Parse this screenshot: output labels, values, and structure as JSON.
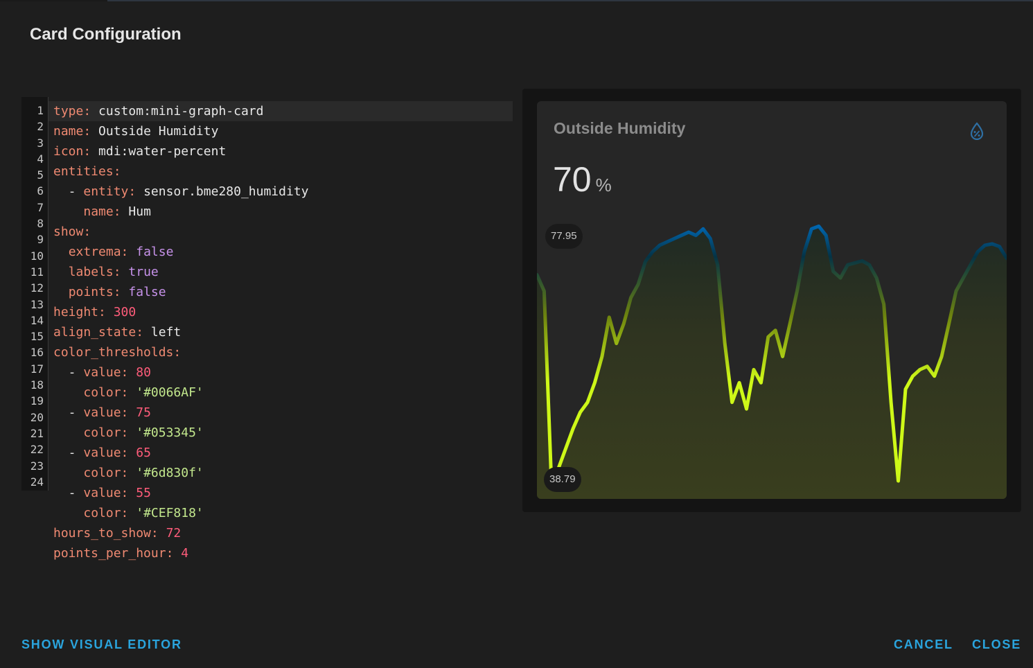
{
  "dialog": {
    "title": "Card Configuration"
  },
  "editor": {
    "line_numbers": [
      "1",
      "2",
      "3",
      "4",
      "5",
      "6",
      "7",
      "8",
      "9",
      "10",
      "11",
      "12",
      "13",
      "14",
      "15",
      "16",
      "17",
      "18",
      "19",
      "20",
      "21",
      "22",
      "23",
      "24"
    ],
    "lines": [
      {
        "indent": "",
        "key": "type",
        "sep": ": ",
        "value": "custom:mini-graph-card",
        "vtype": "s"
      },
      {
        "indent": "",
        "key": "name",
        "sep": ": ",
        "value": "Outside Humidity",
        "vtype": "s"
      },
      {
        "indent": "",
        "key": "icon",
        "sep": ": ",
        "value": "mdi:water-percent",
        "vtype": "s"
      },
      {
        "indent": "",
        "key": "entities",
        "sep": ":",
        "value": "",
        "vtype": "s"
      },
      {
        "indent": "  - ",
        "key": "entity",
        "sep": ": ",
        "value": "sensor.bme280_humidity",
        "vtype": "s"
      },
      {
        "indent": "    ",
        "key": "name",
        "sep": ": ",
        "value": "Hum",
        "vtype": "s"
      },
      {
        "indent": "",
        "key": "show",
        "sep": ":",
        "value": "",
        "vtype": "s"
      },
      {
        "indent": "  ",
        "key": "extrema",
        "sep": ": ",
        "value": "false",
        "vtype": "b"
      },
      {
        "indent": "  ",
        "key": "labels",
        "sep": ": ",
        "value": "true",
        "vtype": "b"
      },
      {
        "indent": "  ",
        "key": "points",
        "sep": ": ",
        "value": "false",
        "vtype": "b"
      },
      {
        "indent": "",
        "key": "height",
        "sep": ": ",
        "value": "300",
        "vtype": "n"
      },
      {
        "indent": "",
        "key": "align_state",
        "sep": ": ",
        "value": "left",
        "vtype": "s"
      },
      {
        "indent": "",
        "key": "color_thresholds",
        "sep": ":",
        "value": "",
        "vtype": "s"
      },
      {
        "indent": "  - ",
        "key": "value",
        "sep": ": ",
        "value": "80",
        "vtype": "n"
      },
      {
        "indent": "    ",
        "key": "color",
        "sep": ": ",
        "value": "'#0066AF'",
        "vtype": "q"
      },
      {
        "indent": "  - ",
        "key": "value",
        "sep": ": ",
        "value": "75",
        "vtype": "n"
      },
      {
        "indent": "    ",
        "key": "color",
        "sep": ": ",
        "value": "'#053345'",
        "vtype": "q"
      },
      {
        "indent": "  - ",
        "key": "value",
        "sep": ": ",
        "value": "65",
        "vtype": "n"
      },
      {
        "indent": "    ",
        "key": "color",
        "sep": ": ",
        "value": "'#6d830f'",
        "vtype": "q"
      },
      {
        "indent": "  - ",
        "key": "value",
        "sep": ": ",
        "value": "55",
        "vtype": "n"
      },
      {
        "indent": "    ",
        "key": "color",
        "sep": ": ",
        "value": "'#CEF818'",
        "vtype": "q"
      },
      {
        "indent": "",
        "key": "hours_to_show",
        "sep": ": ",
        "value": "72",
        "vtype": "n"
      },
      {
        "indent": "",
        "key": "points_per_hour",
        "sep": ": ",
        "value": "4",
        "vtype": "n"
      }
    ]
  },
  "card": {
    "name": "Outside Humidity",
    "icon": "water-percent-icon",
    "state_value": "70",
    "state_unit": "%",
    "label_max": "77.95",
    "label_min": "38.79"
  },
  "chart_data": {
    "type": "area",
    "series": [
      {
        "values": [
          70.5,
          68,
          38.8,
          41,
          44,
          47,
          49.5,
          51,
          54,
          58,
          64,
          60,
          63,
          67,
          69,
          72.5,
          74,
          75,
          75.5,
          76,
          76.5,
          77,
          76.5,
          77.5,
          76,
          72,
          60,
          51,
          54,
          50,
          56,
          54,
          61,
          62,
          58,
          63,
          68,
          74,
          77.5,
          77.9,
          76.5,
          71,
          70,
          72,
          72.3,
          72.6,
          72,
          70,
          66,
          51,
          39,
          53,
          55,
          56,
          56.5,
          55,
          58,
          63,
          68,
          70,
          72,
          74,
          75,
          75.2,
          74.8,
          73
        ]
      }
    ],
    "ylim": [
      38.79,
      77.95
    ],
    "color_thresholds": [
      {
        "value": 80,
        "color": "#0066AF"
      },
      {
        "value": 75,
        "color": "#053345"
      },
      {
        "value": 65,
        "color": "#6d830f"
      },
      {
        "value": 55,
        "color": "#CEF818"
      }
    ]
  },
  "footer": {
    "show_visual_editor": "SHOW VISUAL EDITOR",
    "cancel": "CANCEL",
    "close": "CLOSE"
  },
  "colors": {
    "accent": "#2aa4dd",
    "background": "#1e1e1e"
  }
}
